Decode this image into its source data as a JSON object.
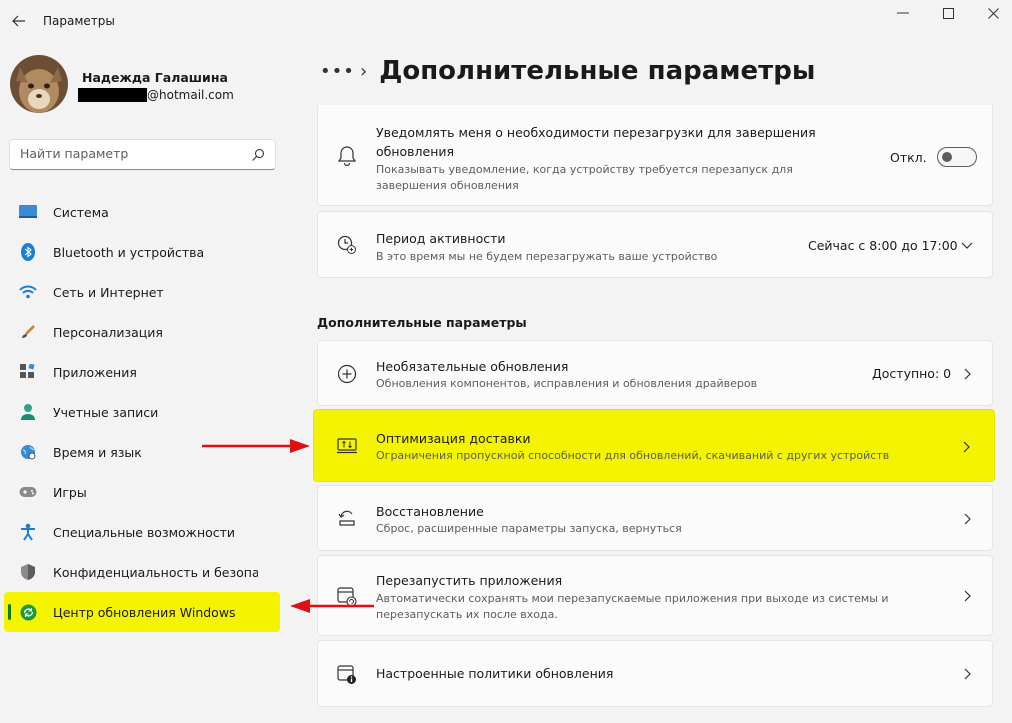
{
  "window": {
    "title": "Параметры"
  },
  "user": {
    "name": "Надежда Галашина",
    "email_suffix": "@hotmail.com"
  },
  "search": {
    "placeholder": "Найти параметр"
  },
  "nav": {
    "items": [
      {
        "label": "Система",
        "icon": "system-icon"
      },
      {
        "label": "Bluetooth и устройства",
        "icon": "bluetooth-icon"
      },
      {
        "label": "Сеть и Интернет",
        "icon": "wifi-icon"
      },
      {
        "label": "Персонализация",
        "icon": "brush-icon"
      },
      {
        "label": "Приложения",
        "icon": "apps-icon"
      },
      {
        "label": "Учетные записи",
        "icon": "account-icon"
      },
      {
        "label": "Время и язык",
        "icon": "globe-icon"
      },
      {
        "label": "Игры",
        "icon": "gamepad-icon"
      },
      {
        "label": "Специальные возможности",
        "icon": "accessibility-icon"
      },
      {
        "label": "Конфиденциальность и безопасность",
        "icon": "shield-icon"
      },
      {
        "label": "Центр обновления Windows",
        "icon": "update-icon",
        "active": true
      }
    ]
  },
  "main": {
    "breadcrumb_more": "•••",
    "title": "Дополнительные параметры",
    "notify": {
      "title_line1": "Уведомлять меня о необходимости перезагрузки для завершения",
      "title_line2": "обновления",
      "desc_line1": "Показывать уведомление, когда устройству требуется перезапуск для",
      "desc_line2": "завершения обновления",
      "toggle_label": "Откл.",
      "toggle_on": false
    },
    "active_hours": {
      "title": "Период активности",
      "desc": "В это время мы не будем перезагружать ваше устройство",
      "value": "Сейчас с 8:00 до 17:00"
    },
    "section_title": "Дополнительные параметры",
    "optional": {
      "title": "Необязательные обновления",
      "desc": "Обновления компонентов, исправления и обновления драйверов",
      "value": "Доступно: 0"
    },
    "delivery": {
      "title": "Оптимизация доставки",
      "desc": "Ограничения пропускной способности для обновлений, скачиваний с других устройств"
    },
    "recovery": {
      "title": "Восстановление",
      "desc": "Сброс, расширенные параметры запуска, вернуться"
    },
    "restart_apps": {
      "title": "Перезапустить приложения",
      "desc_line1": "Автоматически сохранять мои перезапускаемые приложения при выходе из системы и",
      "desc_line2": "перезапускать их после входа."
    },
    "policies": {
      "title": "Настроенные политики обновления"
    }
  },
  "colors": {
    "highlight": "#f4f400",
    "arrow": "#e01010",
    "active_indicator": "#0f7d0f"
  }
}
